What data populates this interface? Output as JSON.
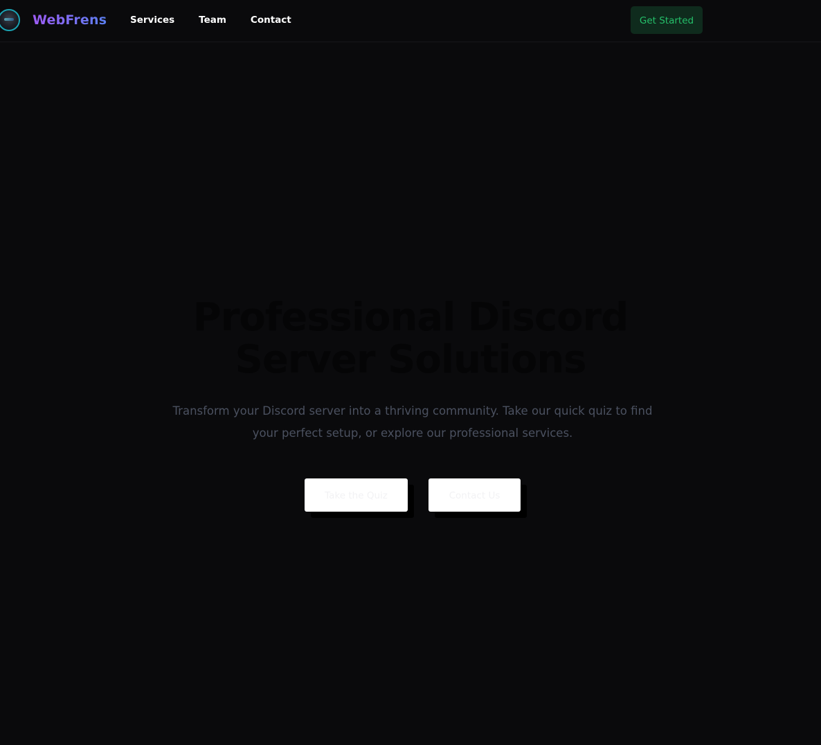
{
  "nav": {
    "brand": "WebFrens",
    "links": [
      "Services",
      "Team",
      "Contact"
    ],
    "cta": "Get Started"
  },
  "hero": {
    "title_line1": "Professional Discord",
    "title_line2": "Server Solutions",
    "subtitle_line1": "Transform your Discord server into a thriving community. Take our quick quiz to find",
    "subtitle_line2": "your perfect setup, or explore our professional services.",
    "primary_button": "Take the Quiz",
    "secondary_button": "Contact Us"
  },
  "colors": {
    "background": "#0a0a0c",
    "brand_gradient_start": "#9d5cf5",
    "brand_gradient_end": "#5b7ff0",
    "cta_bg": "#0f2b1d",
    "cta_text": "#25c06a"
  },
  "icons": {
    "logo": "avatar-logo-icon"
  }
}
